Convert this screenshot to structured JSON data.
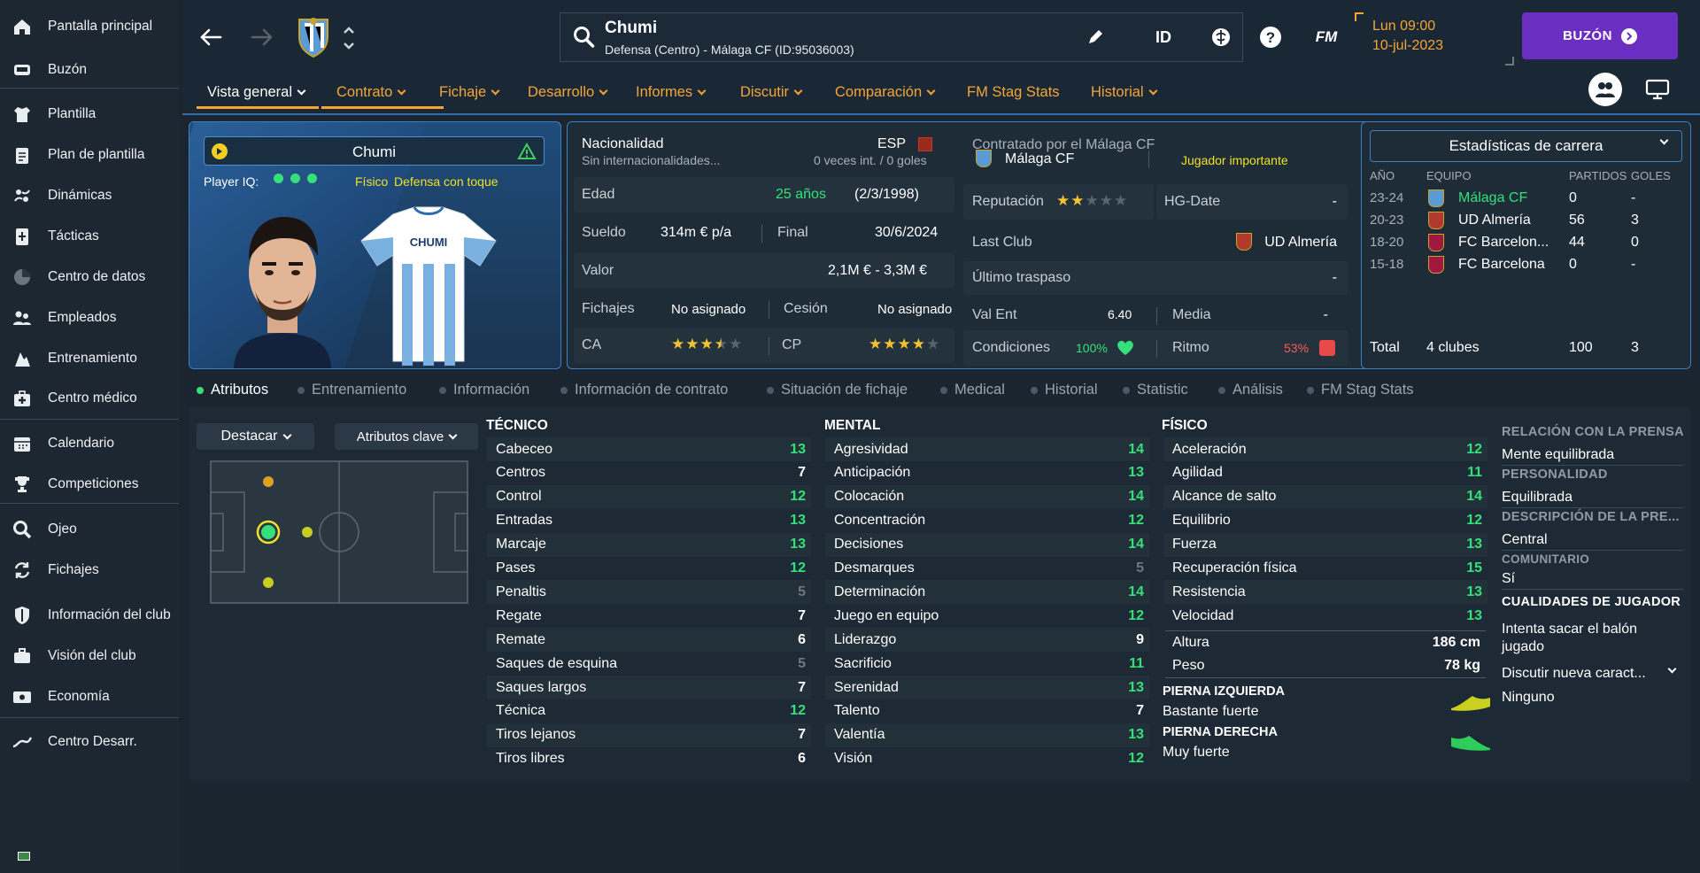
{
  "sidebar": {
    "items": [
      {
        "label": "Pantalla principal",
        "icon": "home-icon"
      },
      {
        "label": "Buzón",
        "icon": "inbox-icon"
      },
      {
        "label": "Plantilla",
        "icon": "shirt-icon"
      },
      {
        "label": "Plan de plantilla",
        "icon": "clipboard-icon"
      },
      {
        "label": "Dinámicas",
        "icon": "dynamics-icon"
      },
      {
        "label": "Tácticas",
        "icon": "tactics-icon"
      },
      {
        "label": "Centro de datos",
        "icon": "data-icon"
      },
      {
        "label": "Empleados",
        "icon": "staff-icon"
      },
      {
        "label": "Entrenamiento",
        "icon": "training-icon"
      },
      {
        "label": "Centro médico",
        "icon": "medical-icon"
      },
      {
        "label": "Calendario",
        "icon": "calendar-icon"
      },
      {
        "label": "Competiciones",
        "icon": "trophy-icon"
      },
      {
        "label": "Ojeo",
        "icon": "scout-icon"
      },
      {
        "label": "Fichajes",
        "icon": "transfers-icon"
      },
      {
        "label": "Información del club",
        "icon": "shield-icon"
      },
      {
        "label": "Visión del club",
        "icon": "briefcase-icon"
      },
      {
        "label": "Economía",
        "icon": "money-icon"
      },
      {
        "label": "Centro Desarr.",
        "icon": "development-icon"
      }
    ]
  },
  "header": {
    "player_name": "Chumi",
    "player_subtitle": "Defensa (Centro) - Málaga CF (ID:95036003)",
    "id_label": "ID",
    "fm_label": "FM",
    "date_day": "Lun 09:00",
    "date": "10-jul-2023",
    "buzon_label": "BUZÓN"
  },
  "menu": [
    {
      "label": "Vista general",
      "dropdown": true,
      "active": true
    },
    {
      "label": "Contrato",
      "dropdown": true
    },
    {
      "label": "Fichaje",
      "dropdown": true
    },
    {
      "label": "Desarrollo",
      "dropdown": true
    },
    {
      "label": "Informes",
      "dropdown": true
    },
    {
      "label": "Discutir",
      "dropdown": true
    },
    {
      "label": "Comparación",
      "dropdown": true
    },
    {
      "label": "FM Stag Stats",
      "dropdown": false
    },
    {
      "label": "Historial",
      "dropdown": true
    }
  ],
  "profile": {
    "name": "Chumi",
    "iq_label": "Player IQ:",
    "role_tag1": "Físico",
    "role_tag2": "Defensa con toque",
    "shirt_name": "CHUMI"
  },
  "info": {
    "nationality_label": "Nacionalidad",
    "nationality_code": "ESP",
    "caps_line": "Sin internacionalidades...",
    "caps_value": "0 veces int. / 0 goles",
    "age_label": "Edad",
    "age_value": "25 años",
    "dob": "(2/3/1998)",
    "salary_label": "Sueldo",
    "salary_value": "314m € p/a",
    "final_label": "Final",
    "final_value": "30/6/2024",
    "value_label": "Valor",
    "value_value": "2,1M € - 3,3M €",
    "fichajes_label": "Fichajes",
    "fichajes_value": "No asignado",
    "cesion_label": "Cesión",
    "cesion_value": "No asignado",
    "ca_label": "CA",
    "ca_stars": 3.5,
    "cp_label": "CP",
    "cp_stars": 4
  },
  "club": {
    "contracted_label": "Contratado por el Málaga CF",
    "club_name": "Málaga CF",
    "status": "Jugador importante",
    "reputation_label": "Reputación",
    "reputation_stars": 2,
    "hg_label": "HG-Date",
    "hg_value": "-",
    "last_club_label": "Last Club",
    "last_club_value": "UD Almería",
    "last_transfer_label": "Último traspaso",
    "last_transfer_value": "-",
    "valent_label": "Val Ent",
    "valent_value": "6.40",
    "media_label": "Media",
    "media_value": "-",
    "condition_label": "Condiciones",
    "condition_value": "100%",
    "rhythm_label": "Ritmo",
    "rhythm_value": "53%"
  },
  "career": {
    "dropdown_label": "Estadísticas de carrera",
    "headers": [
      "AÑO",
      "EQUIPO",
      "PARTIDOS",
      "GOLES"
    ],
    "rows": [
      {
        "year": "23-24",
        "team": "Málaga CF",
        "apps": "0",
        "goals": "-",
        "highlight": true
      },
      {
        "year": "20-23",
        "team": "UD Almería",
        "apps": "56",
        "goals": "3"
      },
      {
        "year": "18-20",
        "team": "FC Barcelon...",
        "apps": "44",
        "goals": "0"
      },
      {
        "year": "15-18",
        "team": "FC Barcelona",
        "apps": "0",
        "goals": "-"
      }
    ],
    "total_label": "Total",
    "total_clubs": "4 clubes",
    "total_apps": "100",
    "total_goals": "3"
  },
  "tabs": [
    "Atributos",
    "Entrenamiento",
    "Información",
    "Información de contrato",
    "Situación de fichaje",
    "Medical",
    "Historial",
    "Statistic",
    "Análisis",
    "FM Stag Stats"
  ],
  "attributes": {
    "highlight_dropdown": "Destacar",
    "key_dropdown": "Atributos clave",
    "technical_title": "TÉCNICO",
    "mental_title": "MENTAL",
    "physical_title": "FÍSICO",
    "technical": [
      {
        "name": "Cabeceo",
        "value": "13",
        "c": "g"
      },
      {
        "name": "Centros",
        "value": "7",
        "c": "w"
      },
      {
        "name": "Control",
        "value": "12",
        "c": "g"
      },
      {
        "name": "Entradas",
        "value": "13",
        "c": "g"
      },
      {
        "name": "Marcaje",
        "value": "13",
        "c": "g"
      },
      {
        "name": "Pases",
        "value": "12",
        "c": "g"
      },
      {
        "name": "Penaltis",
        "value": "5",
        "c": "d"
      },
      {
        "name": "Regate",
        "value": "7",
        "c": "w"
      },
      {
        "name": "Remate",
        "value": "6",
        "c": "w"
      },
      {
        "name": "Saques de esquina",
        "value": "5",
        "c": "d"
      },
      {
        "name": "Saques largos",
        "value": "7",
        "c": "w"
      },
      {
        "name": "Técnica",
        "value": "12",
        "c": "g"
      },
      {
        "name": "Tiros lejanos",
        "value": "7",
        "c": "w"
      },
      {
        "name": "Tiros libres",
        "value": "6",
        "c": "w"
      }
    ],
    "mental": [
      {
        "name": "Agresividad",
        "value": "14",
        "c": "g"
      },
      {
        "name": "Anticipación",
        "value": "13",
        "c": "g"
      },
      {
        "name": "Colocación",
        "value": "14",
        "c": "g"
      },
      {
        "name": "Concentración",
        "value": "12",
        "c": "g"
      },
      {
        "name": "Decisiones",
        "value": "14",
        "c": "g"
      },
      {
        "name": "Desmarques",
        "value": "5",
        "c": "d"
      },
      {
        "name": "Determinación",
        "value": "14",
        "c": "g"
      },
      {
        "name": "Juego en equipo",
        "value": "12",
        "c": "g"
      },
      {
        "name": "Liderazgo",
        "value": "9",
        "c": "w"
      },
      {
        "name": "Sacrificio",
        "value": "11",
        "c": "g"
      },
      {
        "name": "Serenidad",
        "value": "13",
        "c": "g"
      },
      {
        "name": "Talento",
        "value": "7",
        "c": "w"
      },
      {
        "name": "Valentía",
        "value": "13",
        "c": "g"
      },
      {
        "name": "Visión",
        "value": "12",
        "c": "g"
      }
    ],
    "physical": [
      {
        "name": "Aceleración",
        "value": "12",
        "c": "g"
      },
      {
        "name": "Agilidad",
        "value": "11",
        "c": "g"
      },
      {
        "name": "Alcance de salto",
        "value": "14",
        "c": "g"
      },
      {
        "name": "Equilibrio",
        "value": "12",
        "c": "g"
      },
      {
        "name": "Fuerza",
        "value": "13",
        "c": "g"
      },
      {
        "name": "Recuperación física",
        "value": "15",
        "c": "g"
      },
      {
        "name": "Resistencia",
        "value": "13",
        "c": "g"
      },
      {
        "name": "Velocidad",
        "value": "13",
        "c": "g"
      }
    ],
    "height_label": "Altura",
    "height_value": "186 cm",
    "weight_label": "Peso",
    "weight_value": "78 kg",
    "left_foot_title": "PIERNA IZQUIERDA",
    "left_foot_value": "Bastante fuerte",
    "right_foot_title": "PIERNA DERECHA",
    "right_foot_value": "Muy fuerte"
  },
  "personality": {
    "press_title": "RELACIÓN CON LA PRENSA",
    "press_value": "Mente equilibrada",
    "personality_title": "PERSONALIDAD",
    "personality_value": "Equilibrada",
    "press_desc_title": "DESCRIPCIÓN DE LA PRE...",
    "press_desc_value": "Central",
    "community_title": "COMUNITARIO",
    "community_value": "Sí",
    "qualities_title": "CUALIDADES DE JUGADOR",
    "qualities_value": "Intenta sacar el balón jugado",
    "discuss_label": "Discutir nueva caract...",
    "none_value": "Ninguno"
  },
  "colors": {
    "accent": "#f4a536",
    "green": "#35e07a",
    "panel_border": "#3d7fc4",
    "buzon": "#6a2fc0"
  }
}
